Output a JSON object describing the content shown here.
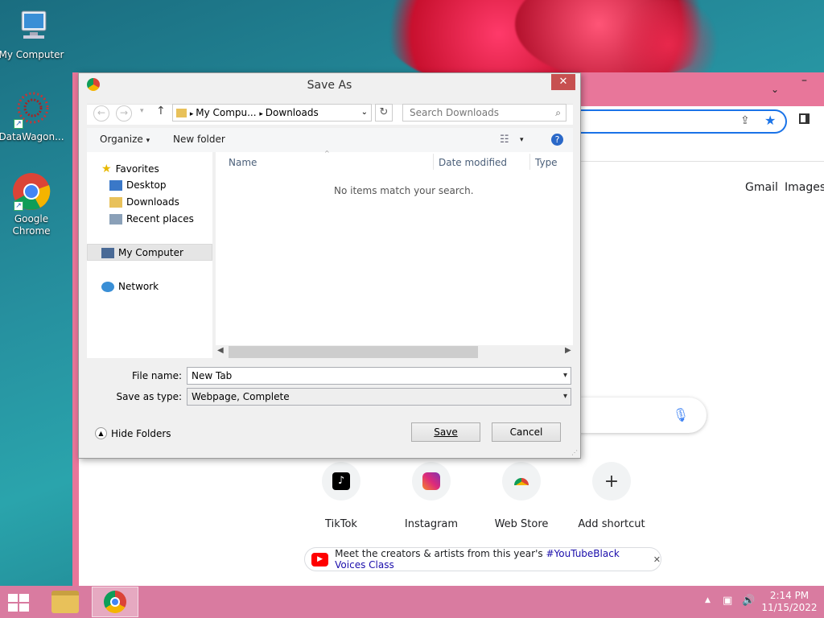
{
  "desktop": {
    "icons": [
      {
        "label": "My Computer",
        "icon": "computer-icon"
      },
      {
        "label": "DataWagon...",
        "icon": "datawagon-icon"
      },
      {
        "label": "Google Chrome",
        "icon": "chrome-icon"
      }
    ]
  },
  "browser": {
    "top_links": [
      "Gmail",
      "Images"
    ],
    "shortcuts": [
      {
        "label": "TikTok",
        "icon": "tiktok-icon"
      },
      {
        "label": "Instagram",
        "icon": "instagram-icon"
      },
      {
        "label": "Web Store",
        "icon": "webstore-icon"
      },
      {
        "label": "Add shortcut",
        "icon": "plus-icon"
      }
    ],
    "promo": {
      "text": "Meet the creators & artists from this year's ",
      "highlight": "#YouTubeBlack Voices Class",
      "close": "✕"
    }
  },
  "dialog": {
    "title": "Save As",
    "close": "✕",
    "path": [
      "My Compu...",
      "Downloads"
    ],
    "search_placeholder": "Search Downloads",
    "toolbar": {
      "organize": "Organize",
      "new_folder": "New folder"
    },
    "nav": {
      "favorites": "Favorites",
      "desktop": "Desktop",
      "downloads": "Downloads",
      "recent": "Recent places",
      "computer": "My Computer",
      "network": "Network"
    },
    "columns": {
      "name": "Name",
      "date": "Date modified",
      "type": "Type"
    },
    "empty_text": "No items match your search.",
    "file_name_label": "File name:",
    "file_name_value": "New Tab",
    "save_type_label": "Save as type:",
    "save_type_value": "Webpage, Complete",
    "hide_folders": "Hide Folders",
    "save_button": "Save",
    "cancel_button": "Cancel"
  },
  "taskbar": {
    "time": "2:14 PM",
    "date": "11/15/2022"
  }
}
